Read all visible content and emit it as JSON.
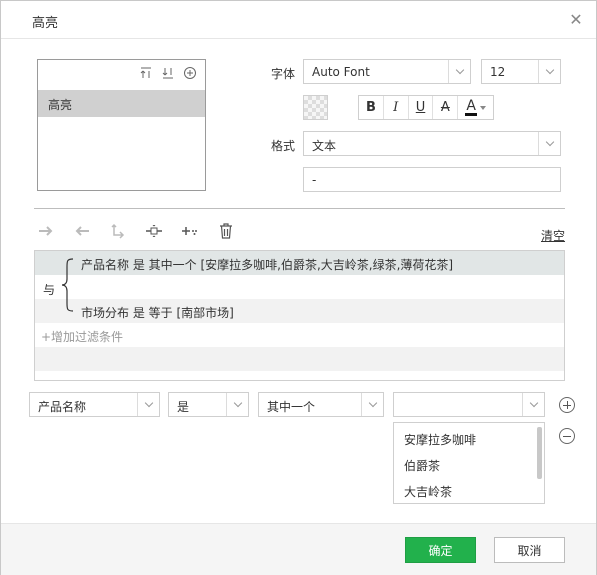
{
  "dialog": {
    "title": "高亮"
  },
  "rules_list": {
    "items": [
      "高亮"
    ]
  },
  "font": {
    "label": "字体",
    "family": "Auto Font",
    "size": "12"
  },
  "format_buttons": {
    "bold": "B",
    "italic": "I",
    "underline": "U",
    "strike": "A",
    "color": "A"
  },
  "format": {
    "label": "格式",
    "type": "文本",
    "value": "-"
  },
  "filter": {
    "clear_label": "清空",
    "and_label": "与",
    "conditions": [
      "产品名称 是 其中一个 [安摩拉多咖啡,伯爵茶,大吉岭茶,绿茶,薄荷花茶]",
      "市场分布 是 等于 [南部市场]"
    ],
    "add_label": "+增加过滤条件"
  },
  "editor": {
    "field": "产品名称",
    "operator": "是",
    "mode": "其中一个",
    "value": ""
  },
  "value_options": [
    "安摩拉多咖啡",
    "伯爵茶",
    "大吉岭茶"
  ],
  "footer": {
    "ok_label": "确定",
    "cancel_label": "取消"
  },
  "colors": {
    "ok_button": "#22b14c",
    "selected_row": "#d0d0d0"
  }
}
